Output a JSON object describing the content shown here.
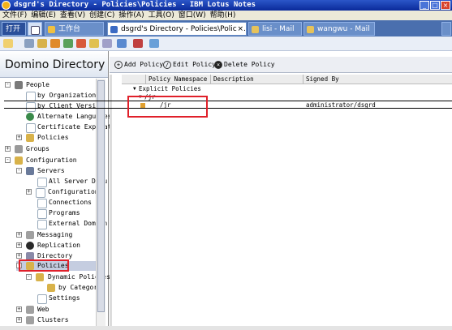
{
  "window": {
    "title": "dsgrd's Directory - Policies\\Policies - IBM Lotus Notes"
  },
  "menu": [
    "文件(F)",
    "编辑(E)",
    "查看(V)",
    "创建(C)",
    "操作(A)",
    "工具(O)",
    "窗口(W)",
    "帮助(H)"
  ],
  "tabs": {
    "open": "打开",
    "workbench": "工作台",
    "directory": "dsgrd's Directory - Policies\\Polici...",
    "lisi": "lisi - Mail",
    "wangwu": "wangwu - Mail"
  },
  "navigator": {
    "title": "Domino Directory",
    "items": [
      {
        "label": "People"
      },
      {
        "label": "by Organization"
      },
      {
        "label": "by Client Version"
      },
      {
        "label": "Alternate Languages"
      },
      {
        "label": "Certificate Expirat"
      },
      {
        "label": "Policies"
      },
      {
        "label": "Groups"
      },
      {
        "label": "Configuration"
      },
      {
        "label": "Servers"
      },
      {
        "label": "All Server Docu"
      },
      {
        "label": "Configurations"
      },
      {
        "label": "Connections"
      },
      {
        "label": "Programs"
      },
      {
        "label": "External Domain"
      },
      {
        "label": "Messaging"
      },
      {
        "label": "Replication"
      },
      {
        "label": "Directory"
      },
      {
        "label": "Policies"
      },
      {
        "label": "Dynamic Policies"
      },
      {
        "label": "by Category"
      },
      {
        "label": "Settings"
      },
      {
        "label": "Web"
      },
      {
        "label": "Clusters"
      }
    ]
  },
  "actions": {
    "add": "Add Policy",
    "edit": "Edit Policy",
    "delete": "Delete Policy"
  },
  "view": {
    "columns": [
      "Policy Namespace",
      "Description",
      "Signed By"
    ],
    "category": "Explicit Policies",
    "subcategory": "/jr",
    "row": {
      "name": "/jr",
      "signed_by": "administrator/dsgrd"
    }
  },
  "colors": {
    "title_bar": "#0a2a9a",
    "tab_bar": "#4a6fae",
    "highlight": "#e0202a",
    "selected": "#c5cde0"
  }
}
